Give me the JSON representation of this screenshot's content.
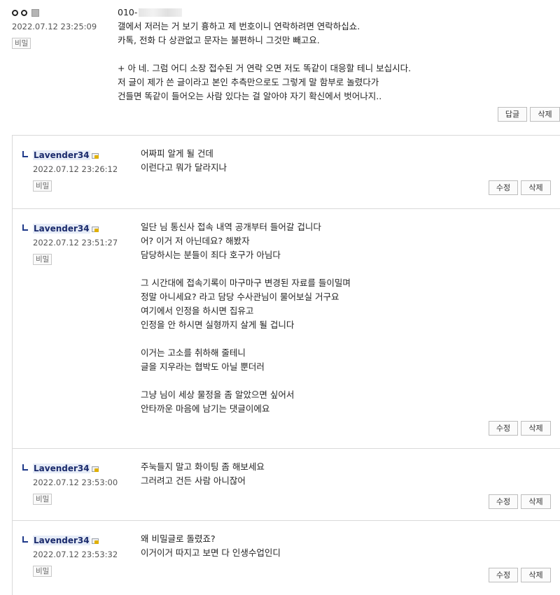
{
  "comments": [
    {
      "date": "2022.07.12 23:25:09",
      "secret_label": "비밀",
      "phone_prefix": "010-",
      "lines": [
        "갤에서 저러는 거 보기 흉하고 제 번호이니 연락하려면 연락하십쇼.",
        "카톡, 전화 다 상관없고 문자는 불편하니 그것만 빼고요.",
        "",
        "+ 아 네. 그럼 어디 소장 접수된 거 연락 오면 저도 똑같이 대응할 테니 보십시다.",
        "저 글이 제가 쓴 글이라고 본인 추측만으로도 그렇게 말 함부로 놀렸다가",
        "건들면 똑같이 들어오는 사람 있다는 걸 알아야 자기 확신에서 벗어나지.."
      ],
      "buttons": [
        "답글",
        "삭제"
      ]
    }
  ],
  "replies": [
    {
      "author": "Lavender34",
      "date": "2022.07.12 23:26:12",
      "secret_label": "비밀",
      "lines": [
        "어짜피 알게 될 건데",
        "이런다고 뭐가 달라지나"
      ],
      "buttons": [
        "수정",
        "삭제"
      ]
    },
    {
      "author": "Lavender34",
      "date": "2022.07.12 23:51:27",
      "secret_label": "비밀",
      "lines": [
        "일단 님 통신사 접속 내역 공개부터 들어갈 겁니다",
        "어? 이거 저 아닌데요? 해봤자",
        "담당하시는 분들이 죄다 호구가 아님다",
        "",
        "그 시간대에 접속기록이 마구마구 변경된 자료를 들이밀며",
        "정말 아니세요? 라고 담당 수사관님이 물어보실 거구요",
        "여기에서 인정을 하시면 집유고",
        "인정을 안 하시면 실형까지 살게 될 겁니다",
        "",
        "이거는 고소를 취하해 줄테니",
        "글을 지우라는 협박도 아닐 뿐더러",
        "",
        "그냥 님이 세상 물정을 좀 알았으면 싶어서",
        "안타까운 마음에 남기는 댓글이에요"
      ],
      "buttons": [
        "수정",
        "삭제"
      ]
    },
    {
      "author": "Lavender34",
      "date": "2022.07.12 23:53:00",
      "secret_label": "비밀",
      "lines": [
        "주눅들지 말고 화이팅 좀 해보세요",
        "그러려고 건든 사람 아니잖어"
      ],
      "buttons": [
        "수정",
        "삭제"
      ]
    },
    {
      "author": "Lavender34",
      "date": "2022.07.12 23:53:32",
      "secret_label": "비밀",
      "lines": [
        "왜 비밀글로 돌렸죠?",
        "이거이거 따지고 보면 다 인생수업인디"
      ],
      "buttons": [
        "수정",
        "삭제"
      ]
    }
  ]
}
